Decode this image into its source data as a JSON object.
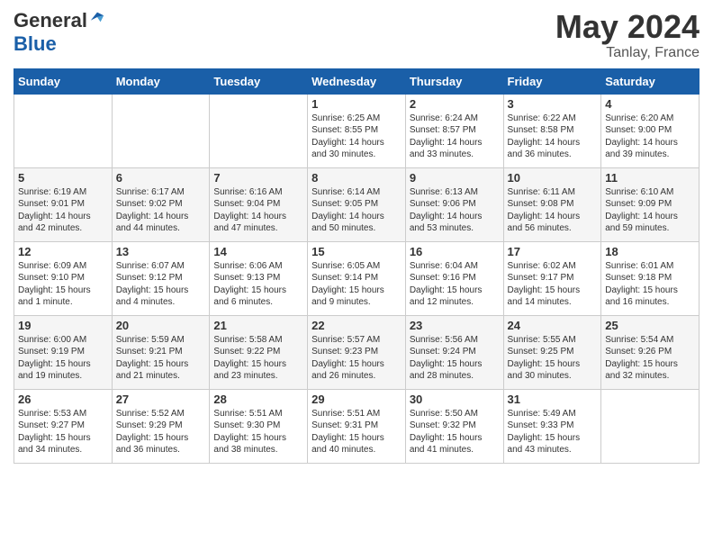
{
  "header": {
    "logo_general": "General",
    "logo_blue": "Blue",
    "month": "May 2024",
    "location": "Tanlay, France"
  },
  "weekdays": [
    "Sunday",
    "Monday",
    "Tuesday",
    "Wednesday",
    "Thursday",
    "Friday",
    "Saturday"
  ],
  "weeks": [
    [
      {
        "day": "",
        "sunrise": "",
        "sunset": "",
        "daylight": ""
      },
      {
        "day": "",
        "sunrise": "",
        "sunset": "",
        "daylight": ""
      },
      {
        "day": "",
        "sunrise": "",
        "sunset": "",
        "daylight": ""
      },
      {
        "day": "1",
        "sunrise": "Sunrise: 6:25 AM",
        "sunset": "Sunset: 8:55 PM",
        "daylight": "Daylight: 14 hours and 30 minutes."
      },
      {
        "day": "2",
        "sunrise": "Sunrise: 6:24 AM",
        "sunset": "Sunset: 8:57 PM",
        "daylight": "Daylight: 14 hours and 33 minutes."
      },
      {
        "day": "3",
        "sunrise": "Sunrise: 6:22 AM",
        "sunset": "Sunset: 8:58 PM",
        "daylight": "Daylight: 14 hours and 36 minutes."
      },
      {
        "day": "4",
        "sunrise": "Sunrise: 6:20 AM",
        "sunset": "Sunset: 9:00 PM",
        "daylight": "Daylight: 14 hours and 39 minutes."
      }
    ],
    [
      {
        "day": "5",
        "sunrise": "Sunrise: 6:19 AM",
        "sunset": "Sunset: 9:01 PM",
        "daylight": "Daylight: 14 hours and 42 minutes."
      },
      {
        "day": "6",
        "sunrise": "Sunrise: 6:17 AM",
        "sunset": "Sunset: 9:02 PM",
        "daylight": "Daylight: 14 hours and 44 minutes."
      },
      {
        "day": "7",
        "sunrise": "Sunrise: 6:16 AM",
        "sunset": "Sunset: 9:04 PM",
        "daylight": "Daylight: 14 hours and 47 minutes."
      },
      {
        "day": "8",
        "sunrise": "Sunrise: 6:14 AM",
        "sunset": "Sunset: 9:05 PM",
        "daylight": "Daylight: 14 hours and 50 minutes."
      },
      {
        "day": "9",
        "sunrise": "Sunrise: 6:13 AM",
        "sunset": "Sunset: 9:06 PM",
        "daylight": "Daylight: 14 hours and 53 minutes."
      },
      {
        "day": "10",
        "sunrise": "Sunrise: 6:11 AM",
        "sunset": "Sunset: 9:08 PM",
        "daylight": "Daylight: 14 hours and 56 minutes."
      },
      {
        "day": "11",
        "sunrise": "Sunrise: 6:10 AM",
        "sunset": "Sunset: 9:09 PM",
        "daylight": "Daylight: 14 hours and 59 minutes."
      }
    ],
    [
      {
        "day": "12",
        "sunrise": "Sunrise: 6:09 AM",
        "sunset": "Sunset: 9:10 PM",
        "daylight": "Daylight: 15 hours and 1 minute."
      },
      {
        "day": "13",
        "sunrise": "Sunrise: 6:07 AM",
        "sunset": "Sunset: 9:12 PM",
        "daylight": "Daylight: 15 hours and 4 minutes."
      },
      {
        "day": "14",
        "sunrise": "Sunrise: 6:06 AM",
        "sunset": "Sunset: 9:13 PM",
        "daylight": "Daylight: 15 hours and 6 minutes."
      },
      {
        "day": "15",
        "sunrise": "Sunrise: 6:05 AM",
        "sunset": "Sunset: 9:14 PM",
        "daylight": "Daylight: 15 hours and 9 minutes."
      },
      {
        "day": "16",
        "sunrise": "Sunrise: 6:04 AM",
        "sunset": "Sunset: 9:16 PM",
        "daylight": "Daylight: 15 hours and 12 minutes."
      },
      {
        "day": "17",
        "sunrise": "Sunrise: 6:02 AM",
        "sunset": "Sunset: 9:17 PM",
        "daylight": "Daylight: 15 hours and 14 minutes."
      },
      {
        "day": "18",
        "sunrise": "Sunrise: 6:01 AM",
        "sunset": "Sunset: 9:18 PM",
        "daylight": "Daylight: 15 hours and 16 minutes."
      }
    ],
    [
      {
        "day": "19",
        "sunrise": "Sunrise: 6:00 AM",
        "sunset": "Sunset: 9:19 PM",
        "daylight": "Daylight: 15 hours and 19 minutes."
      },
      {
        "day": "20",
        "sunrise": "Sunrise: 5:59 AM",
        "sunset": "Sunset: 9:21 PM",
        "daylight": "Daylight: 15 hours and 21 minutes."
      },
      {
        "day": "21",
        "sunrise": "Sunrise: 5:58 AM",
        "sunset": "Sunset: 9:22 PM",
        "daylight": "Daylight: 15 hours and 23 minutes."
      },
      {
        "day": "22",
        "sunrise": "Sunrise: 5:57 AM",
        "sunset": "Sunset: 9:23 PM",
        "daylight": "Daylight: 15 hours and 26 minutes."
      },
      {
        "day": "23",
        "sunrise": "Sunrise: 5:56 AM",
        "sunset": "Sunset: 9:24 PM",
        "daylight": "Daylight: 15 hours and 28 minutes."
      },
      {
        "day": "24",
        "sunrise": "Sunrise: 5:55 AM",
        "sunset": "Sunset: 9:25 PM",
        "daylight": "Daylight: 15 hours and 30 minutes."
      },
      {
        "day": "25",
        "sunrise": "Sunrise: 5:54 AM",
        "sunset": "Sunset: 9:26 PM",
        "daylight": "Daylight: 15 hours and 32 minutes."
      }
    ],
    [
      {
        "day": "26",
        "sunrise": "Sunrise: 5:53 AM",
        "sunset": "Sunset: 9:27 PM",
        "daylight": "Daylight: 15 hours and 34 minutes."
      },
      {
        "day": "27",
        "sunrise": "Sunrise: 5:52 AM",
        "sunset": "Sunset: 9:29 PM",
        "daylight": "Daylight: 15 hours and 36 minutes."
      },
      {
        "day": "28",
        "sunrise": "Sunrise: 5:51 AM",
        "sunset": "Sunset: 9:30 PM",
        "daylight": "Daylight: 15 hours and 38 minutes."
      },
      {
        "day": "29",
        "sunrise": "Sunrise: 5:51 AM",
        "sunset": "Sunset: 9:31 PM",
        "daylight": "Daylight: 15 hours and 40 minutes."
      },
      {
        "day": "30",
        "sunrise": "Sunrise: 5:50 AM",
        "sunset": "Sunset: 9:32 PM",
        "daylight": "Daylight: 15 hours and 41 minutes."
      },
      {
        "day": "31",
        "sunrise": "Sunrise: 5:49 AM",
        "sunset": "Sunset: 9:33 PM",
        "daylight": "Daylight: 15 hours and 43 minutes."
      },
      {
        "day": "",
        "sunrise": "",
        "sunset": "",
        "daylight": ""
      }
    ]
  ]
}
